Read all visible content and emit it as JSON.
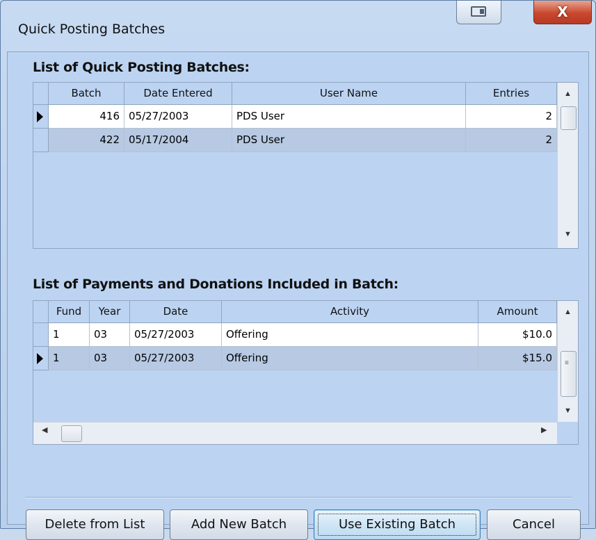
{
  "window": {
    "title": "Quick Posting Batches",
    "close_glyph": "X"
  },
  "batches": {
    "title": "List of Quick Posting Batches:",
    "columns": [
      "Batch",
      "Date Entered",
      "User Name",
      "Entries"
    ],
    "rows": [
      {
        "batch": "416",
        "date": "05/27/2003",
        "user": "PDS User",
        "entries": "2",
        "current": true
      },
      {
        "batch": "422",
        "date": "05/17/2004",
        "user": "PDS User",
        "entries": "2",
        "current": false
      }
    ]
  },
  "payments": {
    "title": "List of Payments and Donations Included in Batch:",
    "columns": [
      "Fund",
      "Year",
      "Date",
      "Activity",
      "Amount"
    ],
    "rows": [
      {
        "fund": "1",
        "year": "03",
        "date": "05/27/2003",
        "activity": "Offering",
        "amount": "$10.0",
        "current": false
      },
      {
        "fund": "1",
        "year": "03",
        "date": "05/27/2003",
        "activity": "Offering",
        "amount": "$15.0",
        "current": true
      }
    ]
  },
  "buttons": {
    "delete": "Delete from List",
    "add": "Add New Batch",
    "use": "Use Existing Batch",
    "cancel": "Cancel"
  },
  "scroll_glyphs": {
    "up": "▲",
    "down": "▼",
    "left": "◀",
    "right": "▶",
    "grip": "≡"
  },
  "colors": {
    "selected_row": "#b7c9e3",
    "window_bg": "#bcd4f2",
    "close_button": "#c9472f"
  }
}
